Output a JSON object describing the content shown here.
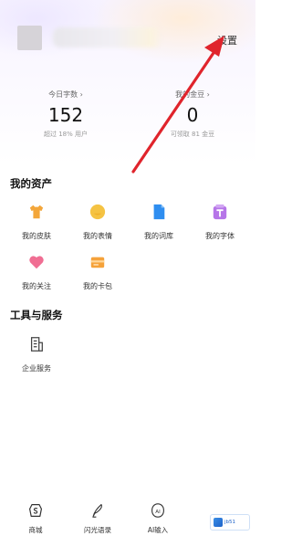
{
  "header": {
    "settings_label": "设置"
  },
  "stats": [
    {
      "label": "今日字数 ›",
      "value": "152",
      "sub": "超过 18% 用户"
    },
    {
      "label": "我的金豆 ›",
      "value": "0",
      "sub": "可领取 81 金豆"
    }
  ],
  "assets": {
    "title": "我的资产",
    "items": [
      {
        "label": "我的皮肤",
        "icon": "shirt-icon",
        "color": "#f3a63a"
      },
      {
        "label": "我的表情",
        "icon": "emoji-icon",
        "color": "#f5c343"
      },
      {
        "label": "我的词库",
        "icon": "lexicon-icon",
        "color": "#2f8ef0"
      },
      {
        "label": "我的字体",
        "icon": "font-icon",
        "color": "#b675e8"
      },
      {
        "label": "我的关注",
        "icon": "heart-icon",
        "color": "#f06e93"
      },
      {
        "label": "我的卡包",
        "icon": "card-icon",
        "color": "#f5a23a"
      }
    ]
  },
  "tools": {
    "title": "工具与服务",
    "items": [
      {
        "label": "企业服务",
        "icon": "enterprise-icon"
      }
    ]
  },
  "bottom_nav": [
    {
      "label": "商城",
      "icon": "store-icon"
    },
    {
      "label": "闪光语录",
      "icon": "quote-icon"
    },
    {
      "label": "AI输入",
      "icon": "ai-input-icon"
    }
  ],
  "annotation": {
    "arrow_color": "#e0242c"
  },
  "watermark": {
    "text": "jb51"
  }
}
